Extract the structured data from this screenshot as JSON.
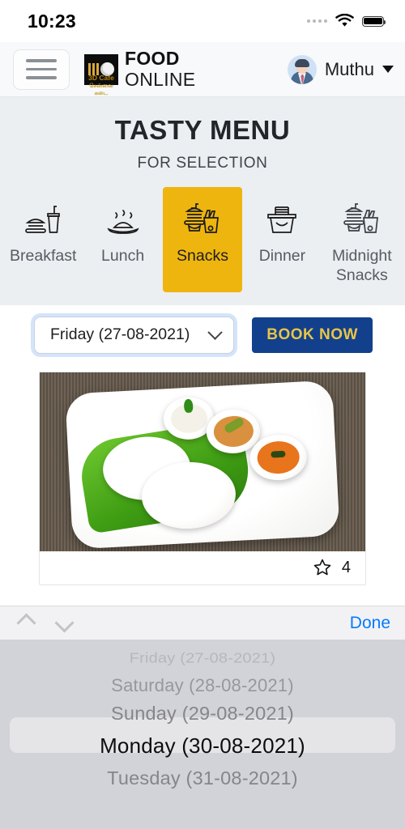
{
  "statusbar": {
    "time": "10:23",
    "signal_icon": "signal-dots-icon",
    "wifi_icon": "wifi-icon",
    "battery_icon": "battery-full-icon"
  },
  "header": {
    "menu_icon": "hamburger-menu-icon",
    "logo_icon": "3d-cafe-logo-icon",
    "logo_sub_main": "3D Cafe",
    "logo_sub_l2": "சென்னை",
    "logo_sub_l3": "கடை",
    "brand_line1": "FOOD",
    "brand_line2": "ONLINE",
    "avatar_icon": "user-avatar-icon",
    "user_name": "Muthu",
    "dropdown_icon": "caret-down-icon"
  },
  "menu": {
    "title": "TASTY MENU",
    "subtitle": "FOR SELECTION",
    "categories": [
      {
        "label": "Breakfast",
        "icon": "burger-drink-icon",
        "active": false
      },
      {
        "label": "Lunch",
        "icon": "hot-plate-icon",
        "active": false
      },
      {
        "label": "Snacks",
        "icon": "burger-fries-drink-icon",
        "active": true
      },
      {
        "label": "Dinner",
        "icon": "noodle-box-icon",
        "active": false
      },
      {
        "label": "Midnight Snacks",
        "icon": "burger-fries-drink-icon",
        "active": false
      }
    ],
    "active_color": "#eeb50f",
    "section_bg": "#eceff1"
  },
  "booking": {
    "date_value": "Friday (27-08-2021)",
    "date_chevron_icon": "chevron-down-icon",
    "book_button_label": "BOOK NOW",
    "book_button_bg": "#12408c",
    "book_button_text_color": "#e8c547"
  },
  "food_card": {
    "image_icon": "idli-plate-photo",
    "rating_star_icon": "star-outline-icon",
    "rating_value": "4"
  },
  "picker": {
    "prev_icon": "chevron-up-icon",
    "next_icon": "chevron-down-icon",
    "done_label": "Done",
    "done_color": "#047aff",
    "options": [
      "Friday (27-08-2021)",
      "Saturday (28-08-2021)",
      "Sunday (29-08-2021)",
      "Monday (30-08-2021)",
      "Tuesday (31-08-2021)"
    ],
    "selected": "Monday (30-08-2021)",
    "selected_index": 3
  }
}
